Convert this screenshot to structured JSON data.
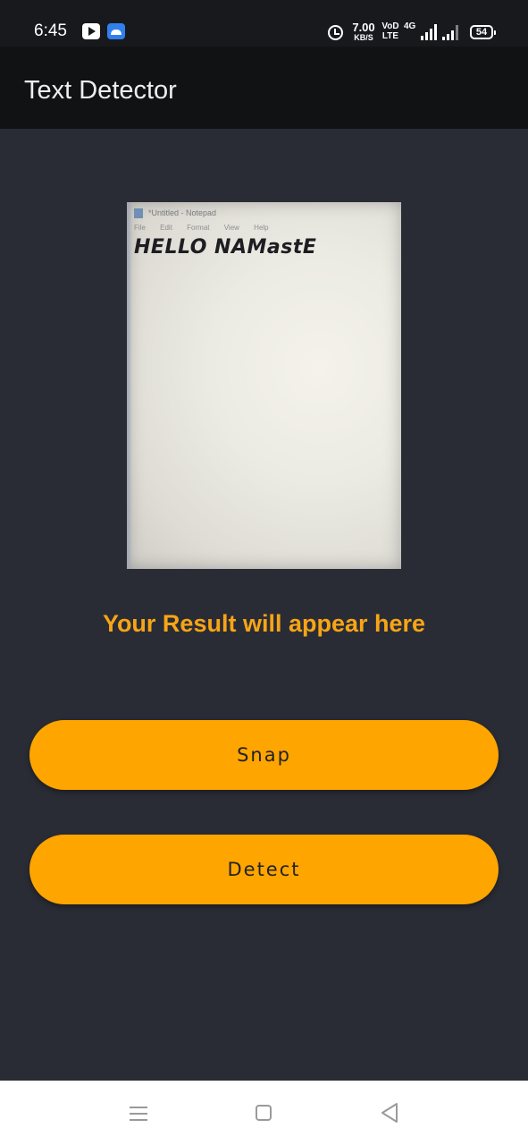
{
  "status_bar": {
    "time": "6:45",
    "notification_icons": [
      "youtube-icon",
      "android-icon"
    ],
    "net_speed_value": "7.00",
    "net_speed_unit": "KB/S",
    "volte_line1": "VoD",
    "volte_line2": "LTE",
    "network_type": "4G",
    "battery_level": "54"
  },
  "app_bar": {
    "title": "Text Detector"
  },
  "preview": {
    "notepad_title": "*Untitled - Notepad",
    "notepad_menu": [
      "File",
      "Edit",
      "Format",
      "View",
      "Help"
    ],
    "captured_text": "HELLO NAMastE"
  },
  "result": {
    "text": "Your Result will appear here",
    "color": "#f7a516"
  },
  "buttons": {
    "snap_label": "Snap",
    "detect_label": "Detect",
    "color": "#ffa500"
  },
  "nav_bar": {
    "icons": [
      "menu-icon",
      "home-icon",
      "back-icon"
    ]
  },
  "colors": {
    "background": "#2a2c35",
    "app_bar": "#111214",
    "status_bar": "#18191d"
  }
}
